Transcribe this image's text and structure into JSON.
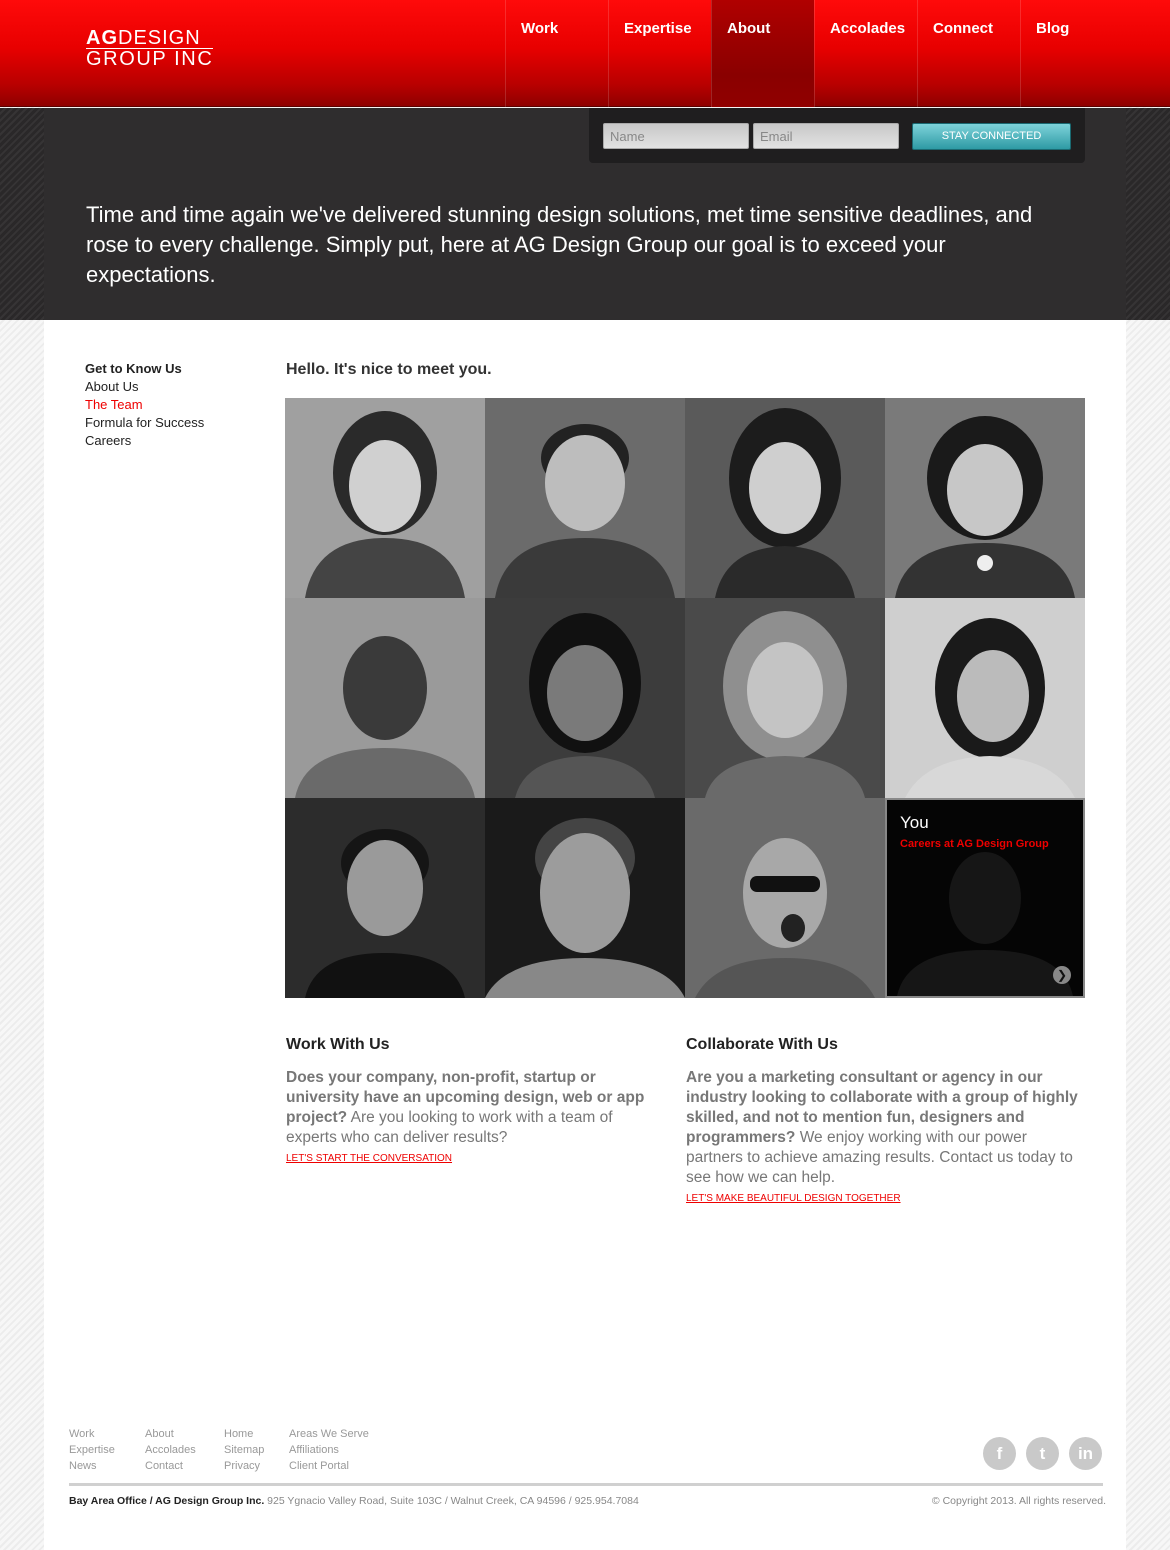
{
  "header": {
    "logo_ag": "AG",
    "logo_design": "DESIGN",
    "logo_line2": "GROUP INC",
    "nav": [
      "Work",
      "Expertise",
      "About",
      "Accolades",
      "Connect",
      "Blog"
    ],
    "active_nav": "About"
  },
  "signup": {
    "name_placeholder": "Name",
    "email_placeholder": "Email",
    "button_label": "STAY CONNECTED"
  },
  "hero": {
    "text": "Time and time again we've delivered stunning design solutions, met time sensitive deadlines, and rose to every challenge. Simply put, here at AG Design Group our goal is to exceed your expectations."
  },
  "sidenav": {
    "heading": "Get to Know Us",
    "items": [
      "About Us",
      "The Team",
      "Formula for Success",
      "Careers"
    ],
    "current": "The Team"
  },
  "team": {
    "greeting": "Hello. It's nice to meet you.",
    "you_title": "You",
    "you_link": "Careers at AG Design Group"
  },
  "work": {
    "title": "Work With Us",
    "lead": "Does your company, non-profit, startup or university have an upcoming design, web or app project?",
    "body": " Are you looking to work with a team of experts who can deliver results?",
    "cta": "LET'S START THE CONVERSATION"
  },
  "collab": {
    "title": "Collaborate With Us",
    "lead": "Are you a marketing consultant or agency in our industry looking to collaborate with a group of highly skilled, and not to mention fun, designers and programmers?",
    "body": " We enjoy working with our power partners to achieve amazing results. Contact us today to see how we can help.",
    "cta": "LET'S MAKE BEAUTIFUL DESIGN TOGETHER"
  },
  "footer": {
    "col1": [
      "Work",
      "Expertise",
      "News"
    ],
    "col2": [
      "About",
      "Accolades",
      "Contact"
    ],
    "col3": [
      "Home",
      "Sitemap",
      "Privacy"
    ],
    "col4": [
      "Areas We Serve",
      "Affiliations",
      "Client Portal"
    ],
    "office": "Bay Area Office / AG Design Group Inc.",
    "address": " 925 Ygnacio Valley Road, Suite 103C / Walnut Creek, CA 94596 / 925.954.7084",
    "copyright": "© Copyright 2013. All rights reserved."
  },
  "social": [
    "facebook-icon",
    "twitter-icon",
    "linkedin-icon"
  ],
  "colors": {
    "brand_red": "#e00000",
    "hero_bg": "#2f2d2e",
    "cta_teal": "#3aa6b0"
  }
}
